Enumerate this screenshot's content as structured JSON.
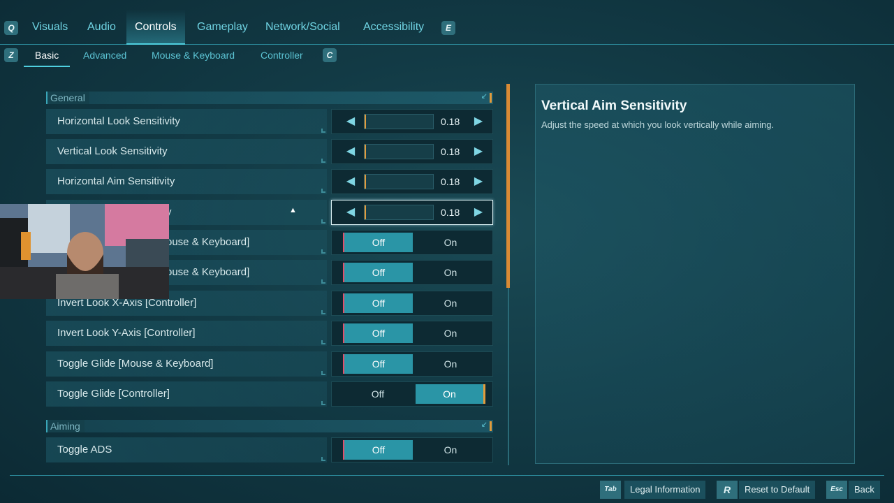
{
  "top_tabs": {
    "left_key": "Q",
    "right_key": "E",
    "items": [
      "Visuals",
      "Audio",
      "Controls",
      "Gameplay",
      "Network/Social",
      "Accessibility"
    ],
    "active": "Controls"
  },
  "sub_tabs": {
    "left_key": "Z",
    "right_key": "C",
    "items": [
      "Basic",
      "Advanced",
      "Mouse & Keyboard",
      "Controller"
    ],
    "active": "Basic"
  },
  "sections": {
    "general": "General",
    "aiming": "Aiming"
  },
  "settings": [
    {
      "label": "Horizontal Look Sensitivity",
      "type": "slider",
      "value": "0.18"
    },
    {
      "label": "Vertical Look Sensitivity",
      "type": "slider",
      "value": "0.18"
    },
    {
      "label": "Horizontal Aim Sensitivity",
      "type": "slider",
      "value": "0.18"
    },
    {
      "label": "y",
      "type": "slider",
      "value": "0.18",
      "selected": true
    },
    {
      "label": "ouse & Keyboard]",
      "type": "toggle",
      "value": "Off"
    },
    {
      "label": "ouse & Keyboard]",
      "type": "toggle",
      "value": "Off"
    },
    {
      "label": "Invert Look X-Axis [Controller]",
      "type": "toggle",
      "value": "Off"
    },
    {
      "label": "Invert Look Y-Axis [Controller]",
      "type": "toggle",
      "value": "Off"
    },
    {
      "label": "Toggle Glide [Mouse & Keyboard]",
      "type": "toggle",
      "value": "Off"
    },
    {
      "label": "Toggle Glide [Controller]",
      "type": "toggle",
      "value": "On"
    },
    {
      "label": "Toggle ADS",
      "type": "toggle",
      "value": "Off"
    }
  ],
  "toggle_labels": {
    "off": "Off",
    "on": "On"
  },
  "description": {
    "title": "Vertical Aim Sensitivity",
    "text": "Adjust the speed at which you look vertically while aiming."
  },
  "footer": {
    "legal_key": "Tab",
    "legal_label": "Legal Information",
    "reset_key": "R",
    "reset_label": "Reset to Default",
    "back_key": "Esc",
    "back_label": "Back"
  },
  "colors": {
    "accent": "#4fd0e0",
    "selected_option": "#2a95a6",
    "highlight_orange": "#e29b3c"
  }
}
